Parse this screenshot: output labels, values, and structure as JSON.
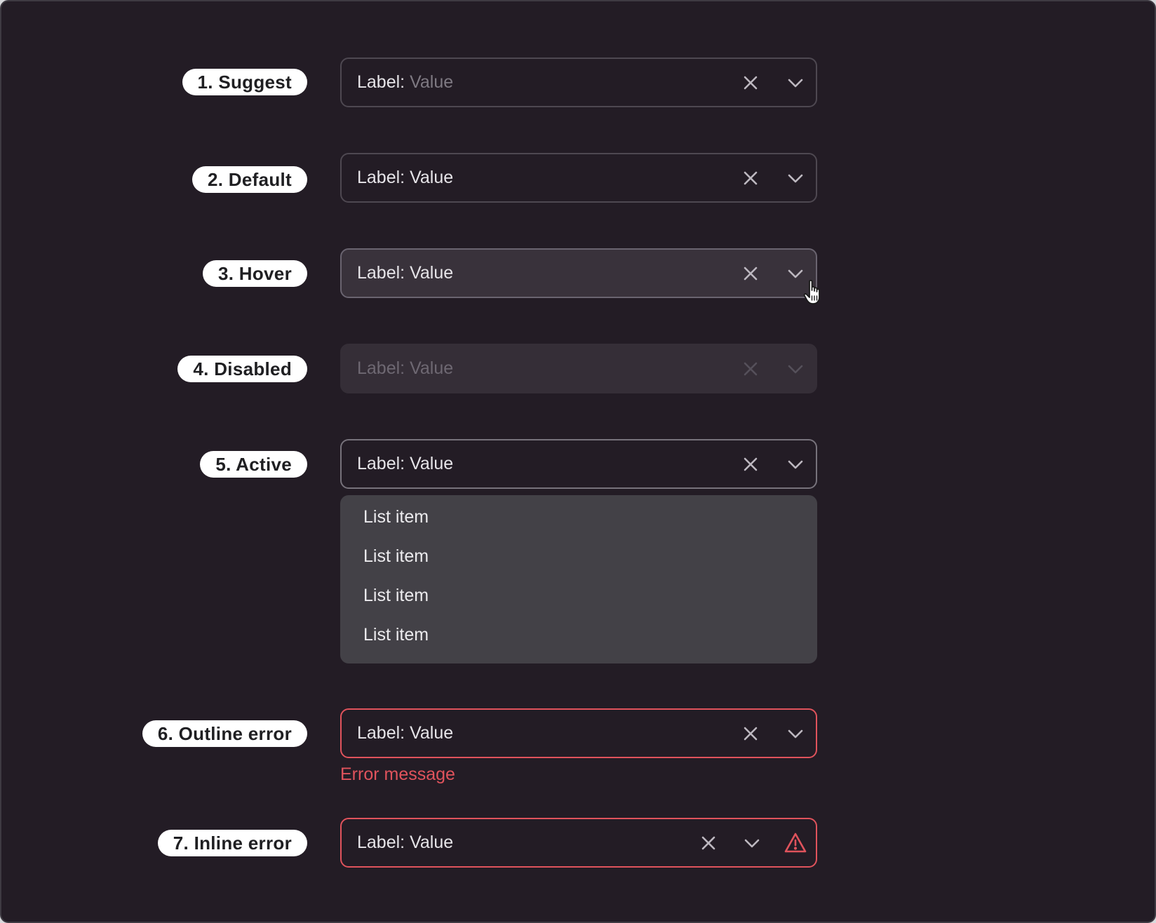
{
  "rows": [
    {
      "tag": "1. Suggest",
      "label": "Label:",
      "value": "Value"
    },
    {
      "tag": "2. Default",
      "label": "Label:",
      "value": "Value"
    },
    {
      "tag": "3. Hover",
      "label": "Label:",
      "value": "Value"
    },
    {
      "tag": "4. Disabled",
      "label": "Label:",
      "value": "Value"
    },
    {
      "tag": "5. Active",
      "label": "Label:",
      "value": "Value"
    },
    {
      "tag": "6. Outline error",
      "label": "Label:",
      "value": "Value"
    },
    {
      "tag": "7. Inline error",
      "label": "Label:",
      "value": "Value"
    }
  ],
  "dropdown": {
    "items": [
      "List item",
      "List item",
      "List item",
      "List item"
    ]
  },
  "error_message": "Error message",
  "icons": {
    "clear": "close-icon",
    "expand": "chevron-down-icon",
    "warning": "warning-triangle-icon",
    "cursor": "hand-pointer-cursor-icon"
  },
  "colors": {
    "background": "#231c25",
    "error": "#e0535c",
    "dropdown": "#434147",
    "tag": "#ffffff"
  }
}
